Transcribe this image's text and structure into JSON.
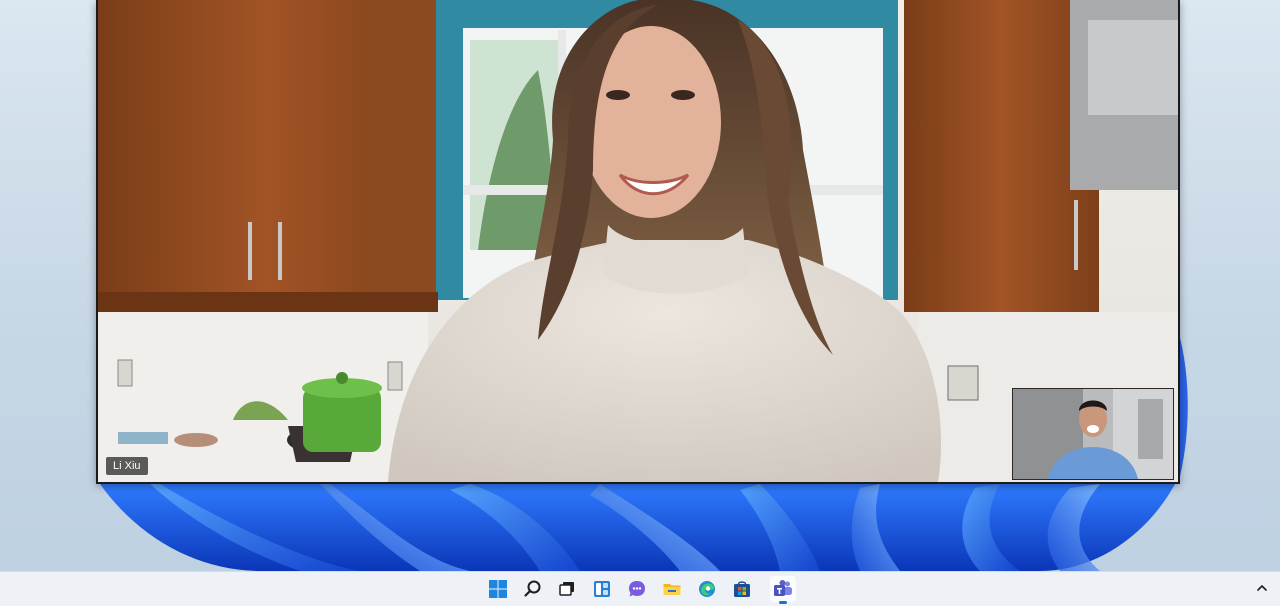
{
  "call": {
    "participant_name": "Li Xiu",
    "self_view": "self-view-camera"
  },
  "taskbar": {
    "icons": [
      {
        "name": "start-icon"
      },
      {
        "name": "search-icon"
      },
      {
        "name": "task-view-icon"
      },
      {
        "name": "widgets-icon"
      },
      {
        "name": "chat-icon"
      },
      {
        "name": "file-explorer-icon"
      },
      {
        "name": "edge-icon"
      },
      {
        "name": "store-icon"
      },
      {
        "name": "teams-icon",
        "active": true
      }
    ],
    "tray": {
      "name": "show-hidden-icons-chevron"
    }
  },
  "colors": {
    "accent": "#1f6fd1",
    "wallpaper_blue": "#1a4fd8",
    "teams_purple": "#5b5fc7"
  }
}
